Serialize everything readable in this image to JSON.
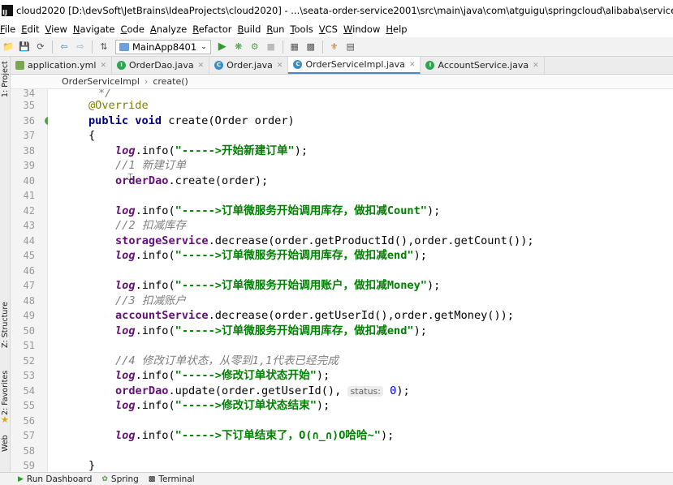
{
  "window": {
    "title": "cloud2020 [D:\\devSoft\\JetBrains\\IdeaProjects\\cloud2020] - ...\\seata-order-service2001\\src\\main\\java\\com\\atguigu\\springcloud\\alibaba\\service\\impl\\OrderServiceImpl.java",
    "app_icon": "IJ"
  },
  "menu": [
    "File",
    "Edit",
    "View",
    "Navigate",
    "Code",
    "Analyze",
    "Refactor",
    "Build",
    "Run",
    "Tools",
    "VCS",
    "Window",
    "Help"
  ],
  "toolbar": {
    "run_config": "MainApp8401"
  },
  "tabs": [
    {
      "label": "application.yml",
      "icon": "yaml-file-icon",
      "active": false
    },
    {
      "label": "OrderDao.java",
      "icon": "interface-icon",
      "active": false
    },
    {
      "label": "Order.java",
      "icon": "class-icon",
      "active": false
    },
    {
      "label": "OrderServiceImpl.java",
      "icon": "class-icon",
      "active": true
    },
    {
      "label": "AccountService.java",
      "icon": "interface-icon",
      "active": false
    }
  ],
  "breadcrumb": {
    "class_name": "OrderServiceImpl",
    "method": "create()"
  },
  "side_tools": {
    "project": "1: Project",
    "structure": "Z: Structure",
    "favorites": "2: Favorites",
    "web": "Web"
  },
  "gutter": {
    "line_numbers": [
      "34",
      "35",
      "36",
      "37",
      "38",
      "39",
      "40",
      "41",
      "42",
      "43",
      "44",
      "45",
      "46",
      "47",
      "48",
      "49",
      "50",
      "51",
      "52",
      "53",
      "54",
      "55",
      "56",
      "57",
      "58",
      "59"
    ]
  },
  "code": {
    "l34": "*/",
    "l35_ann": "@Override",
    "l36_public": "public",
    "l36_void": "void",
    "l36_rest": " create(Order order)",
    "l37": "{",
    "log": "log",
    "info": ".info(",
    "close": ");",
    "l38_str": "\"----->开始新建订单\"",
    "l39_cmt": "//1 新建订单",
    "l40_field": "orderDao",
    "l40_rest": ".create(order);",
    "l42_str": "\"----->订单微服务开始调用库存，做扣减Count\"",
    "l43_cmt": "//2 扣减库存",
    "l44_field": "storageService",
    "l44_rest": ".decrease(order.getProductId(),order.getCount());",
    "l45_str": "\"----->订单微服务开始调用库存，做扣减end\"",
    "l47_str": "\"----->订单微服务开始调用账户，做扣减Money\"",
    "l48_cmt": "//3 扣减账户",
    "l49_field": "accountService",
    "l49_rest": ".decrease(order.getUserId(),order.getMoney());",
    "l50_str": "\"----->订单微服务开始调用库存，做扣减end\"",
    "l52_cmt": "//4 修改订单状态，从零到1,1代表已经完成",
    "l53_str": "\"----->修改订单状态开始\"",
    "l54_field": "orderDao",
    "l54_rest": ".update(order.getUserId(), ",
    "l54_hint": "status:",
    "l54_num": "0",
    "l55_str": "\"----->修改订单状态结束\"",
    "l57_str": "\"----->下订单结束了，O(∩_∩)O哈哈~\"",
    "l59": "}"
  },
  "statusbar": {
    "run_dashboard": "Run Dashboard",
    "spring": "Spring",
    "terminal": "Terminal"
  }
}
